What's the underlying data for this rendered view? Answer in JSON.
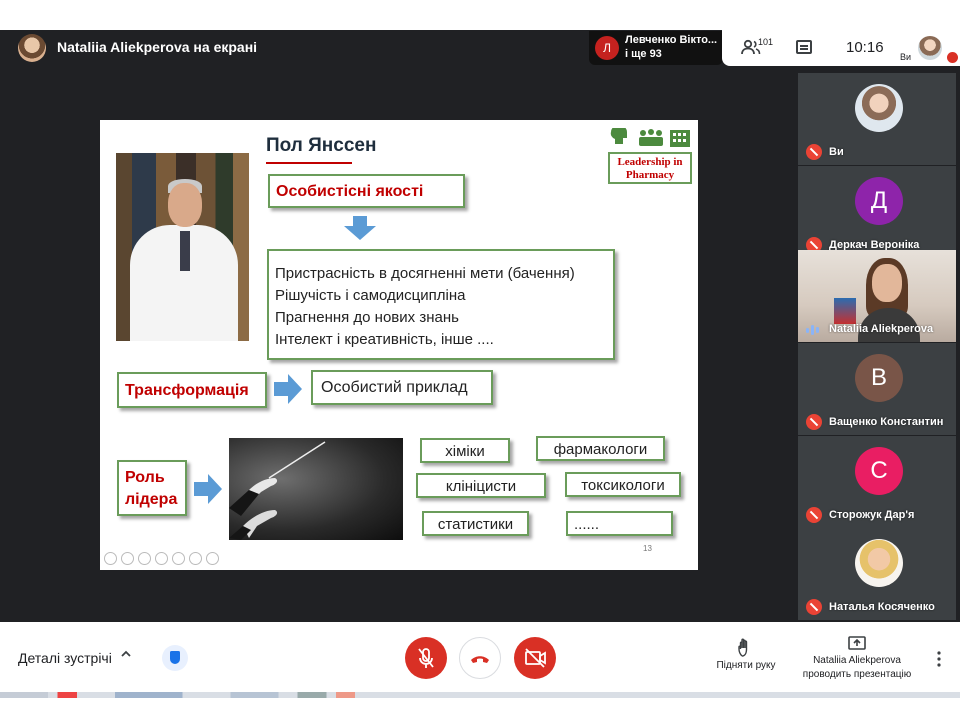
{
  "header": {
    "presenter_title": "Nataliia Aliekperova на екрані",
    "notification": {
      "initial": "Л",
      "line1": "Левченко Вікто...",
      "line2": "і ще 93"
    },
    "people_count": "101",
    "time": "10:16",
    "you_label": "Ви"
  },
  "slide": {
    "title": "Пол Янссен",
    "logo_text_line1": "Leadership in",
    "logo_text_line2": "Pharmacy",
    "qualities_heading": "Особистісні якості",
    "qualities": [
      "Пристрасність в досягненні мети (бачення)",
      "Рішучість і самодисципліна",
      "Прагнення до нових знань",
      "Інтелект і креативність, інше ...."
    ],
    "transformation": "Трансформація",
    "personal_example": "Особистий приклад",
    "leader_role_line1": "Роль",
    "leader_role_line2": "лідера",
    "roles": [
      "хіміки",
      "фармакологи",
      "клініцисти",
      "токсикологи",
      "статистики",
      "......"
    ],
    "slide_number": "13"
  },
  "participants": [
    {
      "name": "Ви",
      "type": "photo",
      "muted": true
    },
    {
      "name": "Деркач Вероніка",
      "initial": "Д",
      "color": "#8e24aa",
      "muted": true
    },
    {
      "name": "Nataliia Aliekperova",
      "type": "video",
      "muted": false
    },
    {
      "name": "Ващенко Константин",
      "initial": "В",
      "color": "#795548",
      "muted": true
    },
    {
      "name": "Сторожук Дар'я",
      "initial": "С",
      "color": "#e91e63",
      "muted": true
    },
    {
      "name": "Наталья Косяченко",
      "type": "photo",
      "muted": true
    }
  ],
  "bottom": {
    "meeting_details": "Деталі зустрічі",
    "raise_hand": "Підняти руку",
    "presenter_line1": "Nataliia Aliekperova",
    "presenter_line2": "проводить презентацію"
  },
  "colors": {
    "end_call_red": "#d93025",
    "accent_red": "#c00000",
    "box_border": "#6a9c5a",
    "arrow_blue": "#5b9bd5"
  }
}
